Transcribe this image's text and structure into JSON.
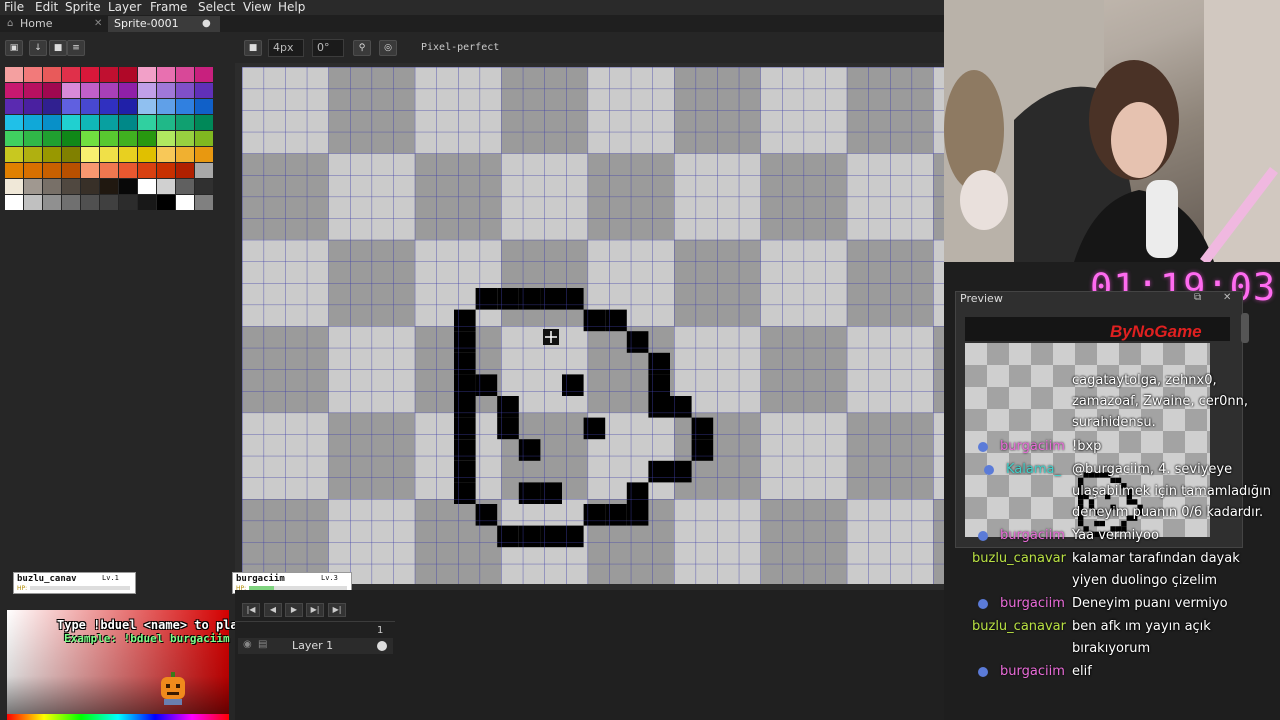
{
  "menu": [
    "File",
    "Edit",
    "Sprite",
    "Layer",
    "Frame",
    "Select",
    "View",
    "Help"
  ],
  "tabs": [
    {
      "label": "Home"
    },
    {
      "label": "Sprite-0001"
    }
  ],
  "toolbar": {
    "brush_size": "4px",
    "angle": "0°",
    "pixel_perfect": "Pixel-perfect"
  },
  "timeline": {
    "frame_number": "1",
    "layer_name": "Layer 1"
  },
  "preview": {
    "title": "Preview",
    "brand": "ByNoGame"
  },
  "timer": "01:19:03",
  "duel": {
    "instruction": "Type !bduel <name> to play",
    "example": "Example: !bduel burgaciim"
  },
  "hp_cards": [
    {
      "name": "buzlu_canav",
      "level": "Lv.1",
      "hp_label": "HP:",
      "hp_fraction": 0.0
    },
    {
      "name": "burgaciim",
      "level": "Lv.3",
      "hp_label": "HP:",
      "hp_fraction": 0.25
    }
  ],
  "chat": [
    {
      "user": "",
      "text": "cagataytolga, zehnx0,"
    },
    {
      "user": "",
      "text": "zamazoaf, Zwaine, cer0nn,"
    },
    {
      "user": "",
      "text": "surahidensu."
    },
    {
      "user": "burgaciim",
      "text": "!bxp"
    },
    {
      "user": "Kalama_",
      "text": "@burgaciim, 4. seviyeye"
    },
    {
      "user": "",
      "text": "ulaşabilmek için tamamladığın"
    },
    {
      "user": "",
      "text": "deneyim puanın 0/6 kadardır."
    },
    {
      "user": "burgaciim",
      "text": "Yaa vermiyoo"
    },
    {
      "user": "buzlu_canavar",
      "text": "kalamar tarafından dayak"
    },
    {
      "user": "",
      "text": "yiyen duolingo çizelim"
    },
    {
      "user": "burgaciim",
      "text": "Deneyim puanı vermiyo"
    },
    {
      "user": "buzlu_canavar",
      "text": "ben afk ım yayın açık"
    },
    {
      "user": "",
      "text": "bırakıyorum"
    },
    {
      "user": "burgaciim",
      "text": "elif"
    }
  ],
  "colors": {
    "burgaciim": "#e96bd8",
    "buzlu_canavar": "#b8e043",
    "kalama": "#3fd0c9",
    "timer": "#ff6bf0",
    "accent": "#d40000"
  },
  "icons": [
    "home-icon",
    "close-icon",
    "dot-icon",
    "stop-icon",
    "move-icon",
    "pixel-perfect-icon",
    "first-frame-icon",
    "prev-frame-icon",
    "play-icon",
    "next-frame-icon",
    "last-frame-icon",
    "eye-icon",
    "lock-icon",
    "crosshair-cursor-icon"
  ]
}
